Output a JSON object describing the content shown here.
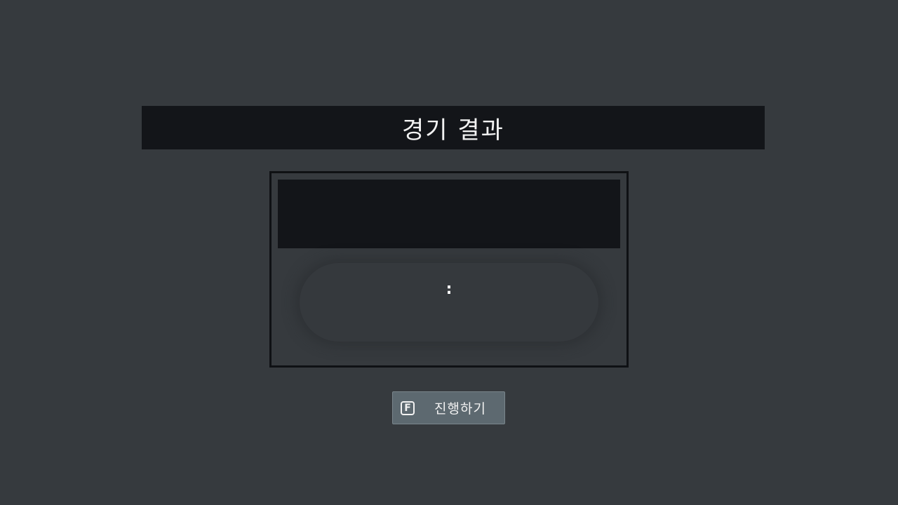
{
  "title": "경기 결과",
  "result": {
    "score_separator": ":"
  },
  "proceed_button": {
    "key": "F",
    "label": "진행하기"
  },
  "colors": {
    "background": "#363a3e",
    "dark_bar": "#131519",
    "button": "#5d6970",
    "text": "#f2f2f2"
  }
}
